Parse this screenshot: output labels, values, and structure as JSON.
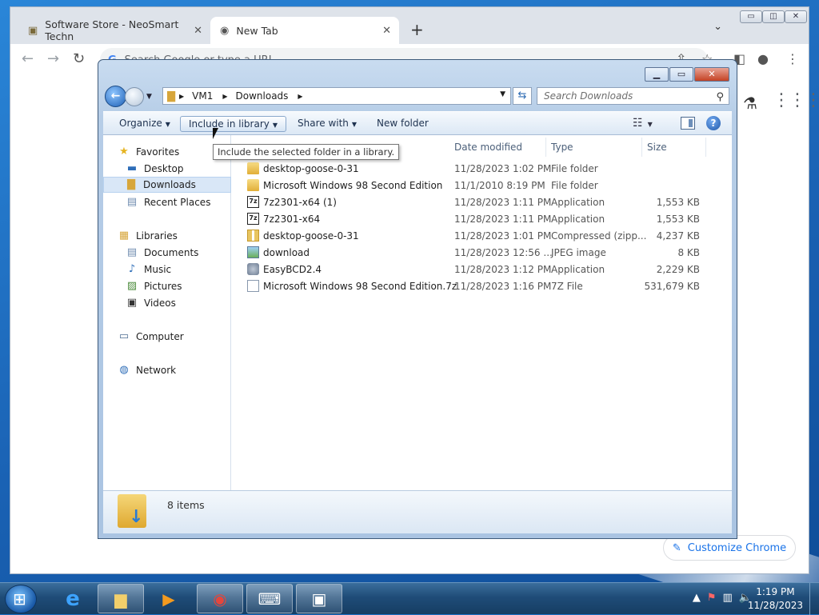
{
  "chrome": {
    "tabs": [
      {
        "title": "Software Store - NeoSmart Techn",
        "close": "✕"
      },
      {
        "title": "New Tab",
        "close": "✕"
      }
    ],
    "new_tab": "+",
    "omnibox_placeholder": "Search Google or type a URL",
    "customize_label": "Customize Chrome"
  },
  "explorer": {
    "breadcrumb": [
      "VM1",
      "Downloads"
    ],
    "search_placeholder": "Search Downloads",
    "commands": {
      "organize": "Organize",
      "include_in_library": "Include in library",
      "share_with": "Share with",
      "new_folder": "New folder"
    },
    "tooltip": "Include the selected folder in a library.",
    "nav": {
      "favorites": "Favorites",
      "desktop": "Desktop",
      "downloads": "Downloads",
      "recent_places": "Recent Places",
      "libraries": "Libraries",
      "documents": "Documents",
      "music": "Music",
      "pictures": "Pictures",
      "videos": "Videos",
      "computer": "Computer",
      "network": "Network"
    },
    "columns": {
      "date": "Date modified",
      "type": "Type",
      "size": "Size"
    },
    "files": [
      {
        "name": "desktop-goose-0-31",
        "date": "11/28/2023 1:02 PM",
        "type": "File folder",
        "size": "",
        "icon": "folder"
      },
      {
        "name": "Microsoft Windows 98 Second Edition",
        "date": "11/1/2010 8:19 PM",
        "type": "File folder",
        "size": "",
        "icon": "folder"
      },
      {
        "name": "7z2301-x64 (1)",
        "date": "11/28/2023 1:11 PM",
        "type": "Application",
        "size": "1,553 KB",
        "icon": "app7z"
      },
      {
        "name": "7z2301-x64",
        "date": "11/28/2023 1:11 PM",
        "type": "Application",
        "size": "1,553 KB",
        "icon": "app7z"
      },
      {
        "name": "desktop-goose-0-31",
        "date": "11/28/2023 1:01 PM",
        "type": "Compressed (zipp...",
        "size": "4,237 KB",
        "icon": "zip"
      },
      {
        "name": "download",
        "date": "11/28/2023 12:56 ...",
        "type": "JPEG image",
        "size": "8 KB",
        "icon": "jpg"
      },
      {
        "name": "EasyBCD2.4",
        "date": "11/28/2023 1:12 PM",
        "type": "Application",
        "size": "2,229 KB",
        "icon": "easy"
      },
      {
        "name": "Microsoft Windows 98 Second Edition.7z",
        "date": "11/28/2023 1:16 PM",
        "type": "7Z File",
        "size": "531,679 KB",
        "icon": "file"
      }
    ],
    "item_count": "8 items"
  },
  "taskbar": {
    "time": "1:19 PM",
    "date": "11/28/2023"
  }
}
